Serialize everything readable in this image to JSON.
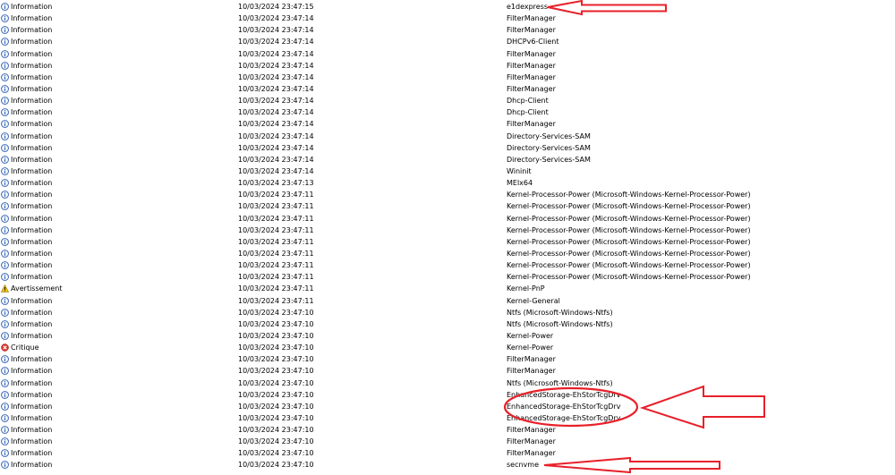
{
  "events": [
    {
      "level": "Information",
      "level_icon": "info-icon",
      "datetime": "10/03/2024 23:47:15",
      "source": "e1dexpress"
    },
    {
      "level": "Information",
      "level_icon": "info-icon",
      "datetime": "10/03/2024 23:47:14",
      "source": "FilterManager"
    },
    {
      "level": "Information",
      "level_icon": "info-icon",
      "datetime": "10/03/2024 23:47:14",
      "source": "FilterManager"
    },
    {
      "level": "Information",
      "level_icon": "info-icon",
      "datetime": "10/03/2024 23:47:14",
      "source": "DHCPv6-Client"
    },
    {
      "level": "Information",
      "level_icon": "info-icon",
      "datetime": "10/03/2024 23:47:14",
      "source": "FilterManager"
    },
    {
      "level": "Information",
      "level_icon": "info-icon",
      "datetime": "10/03/2024 23:47:14",
      "source": "FilterManager"
    },
    {
      "level": "Information",
      "level_icon": "info-icon",
      "datetime": "10/03/2024 23:47:14",
      "source": "FilterManager"
    },
    {
      "level": "Information",
      "level_icon": "info-icon",
      "datetime": "10/03/2024 23:47:14",
      "source": "FilterManager"
    },
    {
      "level": "Information",
      "level_icon": "info-icon",
      "datetime": "10/03/2024 23:47:14",
      "source": "Dhcp-Client"
    },
    {
      "level": "Information",
      "level_icon": "info-icon",
      "datetime": "10/03/2024 23:47:14",
      "source": "Dhcp-Client"
    },
    {
      "level": "Information",
      "level_icon": "info-icon",
      "datetime": "10/03/2024 23:47:14",
      "source": "FilterManager"
    },
    {
      "level": "Information",
      "level_icon": "info-icon",
      "datetime": "10/03/2024 23:47:14",
      "source": "Directory-Services-SAM"
    },
    {
      "level": "Information",
      "level_icon": "info-icon",
      "datetime": "10/03/2024 23:47:14",
      "source": "Directory-Services-SAM"
    },
    {
      "level": "Information",
      "level_icon": "info-icon",
      "datetime": "10/03/2024 23:47:14",
      "source": "Directory-Services-SAM"
    },
    {
      "level": "Information",
      "level_icon": "info-icon",
      "datetime": "10/03/2024 23:47:14",
      "source": "Wininit"
    },
    {
      "level": "Information",
      "level_icon": "info-icon",
      "datetime": "10/03/2024 23:47:13",
      "source": "MElx64"
    },
    {
      "level": "Information",
      "level_icon": "info-icon",
      "datetime": "10/03/2024 23:47:11",
      "source": "Kernel-Processor-Power (Microsoft-Windows-Kernel-Processor-Power)"
    },
    {
      "level": "Information",
      "level_icon": "info-icon",
      "datetime": "10/03/2024 23:47:11",
      "source": "Kernel-Processor-Power (Microsoft-Windows-Kernel-Processor-Power)"
    },
    {
      "level": "Information",
      "level_icon": "info-icon",
      "datetime": "10/03/2024 23:47:11",
      "source": "Kernel-Processor-Power (Microsoft-Windows-Kernel-Processor-Power)"
    },
    {
      "level": "Information",
      "level_icon": "info-icon",
      "datetime": "10/03/2024 23:47:11",
      "source": "Kernel-Processor-Power (Microsoft-Windows-Kernel-Processor-Power)"
    },
    {
      "level": "Information",
      "level_icon": "info-icon",
      "datetime": "10/03/2024 23:47:11",
      "source": "Kernel-Processor-Power (Microsoft-Windows-Kernel-Processor-Power)"
    },
    {
      "level": "Information",
      "level_icon": "info-icon",
      "datetime": "10/03/2024 23:47:11",
      "source": "Kernel-Processor-Power (Microsoft-Windows-Kernel-Processor-Power)"
    },
    {
      "level": "Information",
      "level_icon": "info-icon",
      "datetime": "10/03/2024 23:47:11",
      "source": "Kernel-Processor-Power (Microsoft-Windows-Kernel-Processor-Power)"
    },
    {
      "level": "Information",
      "level_icon": "info-icon",
      "datetime": "10/03/2024 23:47:11",
      "source": "Kernel-Processor-Power (Microsoft-Windows-Kernel-Processor-Power)"
    },
    {
      "level": "Avertissement",
      "level_icon": "warning-icon",
      "datetime": "10/03/2024 23:47:11",
      "source": "Kernel-PnP"
    },
    {
      "level": "Information",
      "level_icon": "info-icon",
      "datetime": "10/03/2024 23:47:11",
      "source": "Kernel-General"
    },
    {
      "level": "Information",
      "level_icon": "info-icon",
      "datetime": "10/03/2024 23:47:10",
      "source": "Ntfs (Microsoft-Windows-Ntfs)"
    },
    {
      "level": "Information",
      "level_icon": "info-icon",
      "datetime": "10/03/2024 23:47:10",
      "source": "Ntfs (Microsoft-Windows-Ntfs)"
    },
    {
      "level": "Information",
      "level_icon": "info-icon",
      "datetime": "10/03/2024 23:47:10",
      "source": "Kernel-Power"
    },
    {
      "level": "Critique",
      "level_icon": "critical-icon",
      "datetime": "10/03/2024 23:47:10",
      "source": "Kernel-Power"
    },
    {
      "level": "Information",
      "level_icon": "info-icon",
      "datetime": "10/03/2024 23:47:10",
      "source": "FilterManager"
    },
    {
      "level": "Information",
      "level_icon": "info-icon",
      "datetime": "10/03/2024 23:47:10",
      "source": "FilterManager"
    },
    {
      "level": "Information",
      "level_icon": "info-icon",
      "datetime": "10/03/2024 23:47:10",
      "source": "Ntfs (Microsoft-Windows-Ntfs)"
    },
    {
      "level": "Information",
      "level_icon": "info-icon",
      "datetime": "10/03/2024 23:47:10",
      "source": "EnhancedStorage-EhStorTcgDrv"
    },
    {
      "level": "Information",
      "level_icon": "info-icon",
      "datetime": "10/03/2024 23:47:10",
      "source": "EnhancedStorage-EhStorTcgDrv"
    },
    {
      "level": "Information",
      "level_icon": "info-icon",
      "datetime": "10/03/2024 23:47:10",
      "source": "EnhancedStorage-EhStorTcgDrv"
    },
    {
      "level": "Information",
      "level_icon": "info-icon",
      "datetime": "10/03/2024 23:47:10",
      "source": "FilterManager"
    },
    {
      "level": "Information",
      "level_icon": "info-icon",
      "datetime": "10/03/2024 23:47:10",
      "source": "FilterManager"
    },
    {
      "level": "Information",
      "level_icon": "info-icon",
      "datetime": "10/03/2024 23:47:10",
      "source": "FilterManager"
    },
    {
      "level": "Information",
      "level_icon": "info-icon",
      "datetime": "10/03/2024 23:47:10",
      "source": "secnvme"
    }
  ],
  "annotation_color": "#e8202a",
  "info_icon_color": "#2f5fb0",
  "warning_icon_color": "#f2c21b",
  "critical_icon_color": "#d9342b"
}
